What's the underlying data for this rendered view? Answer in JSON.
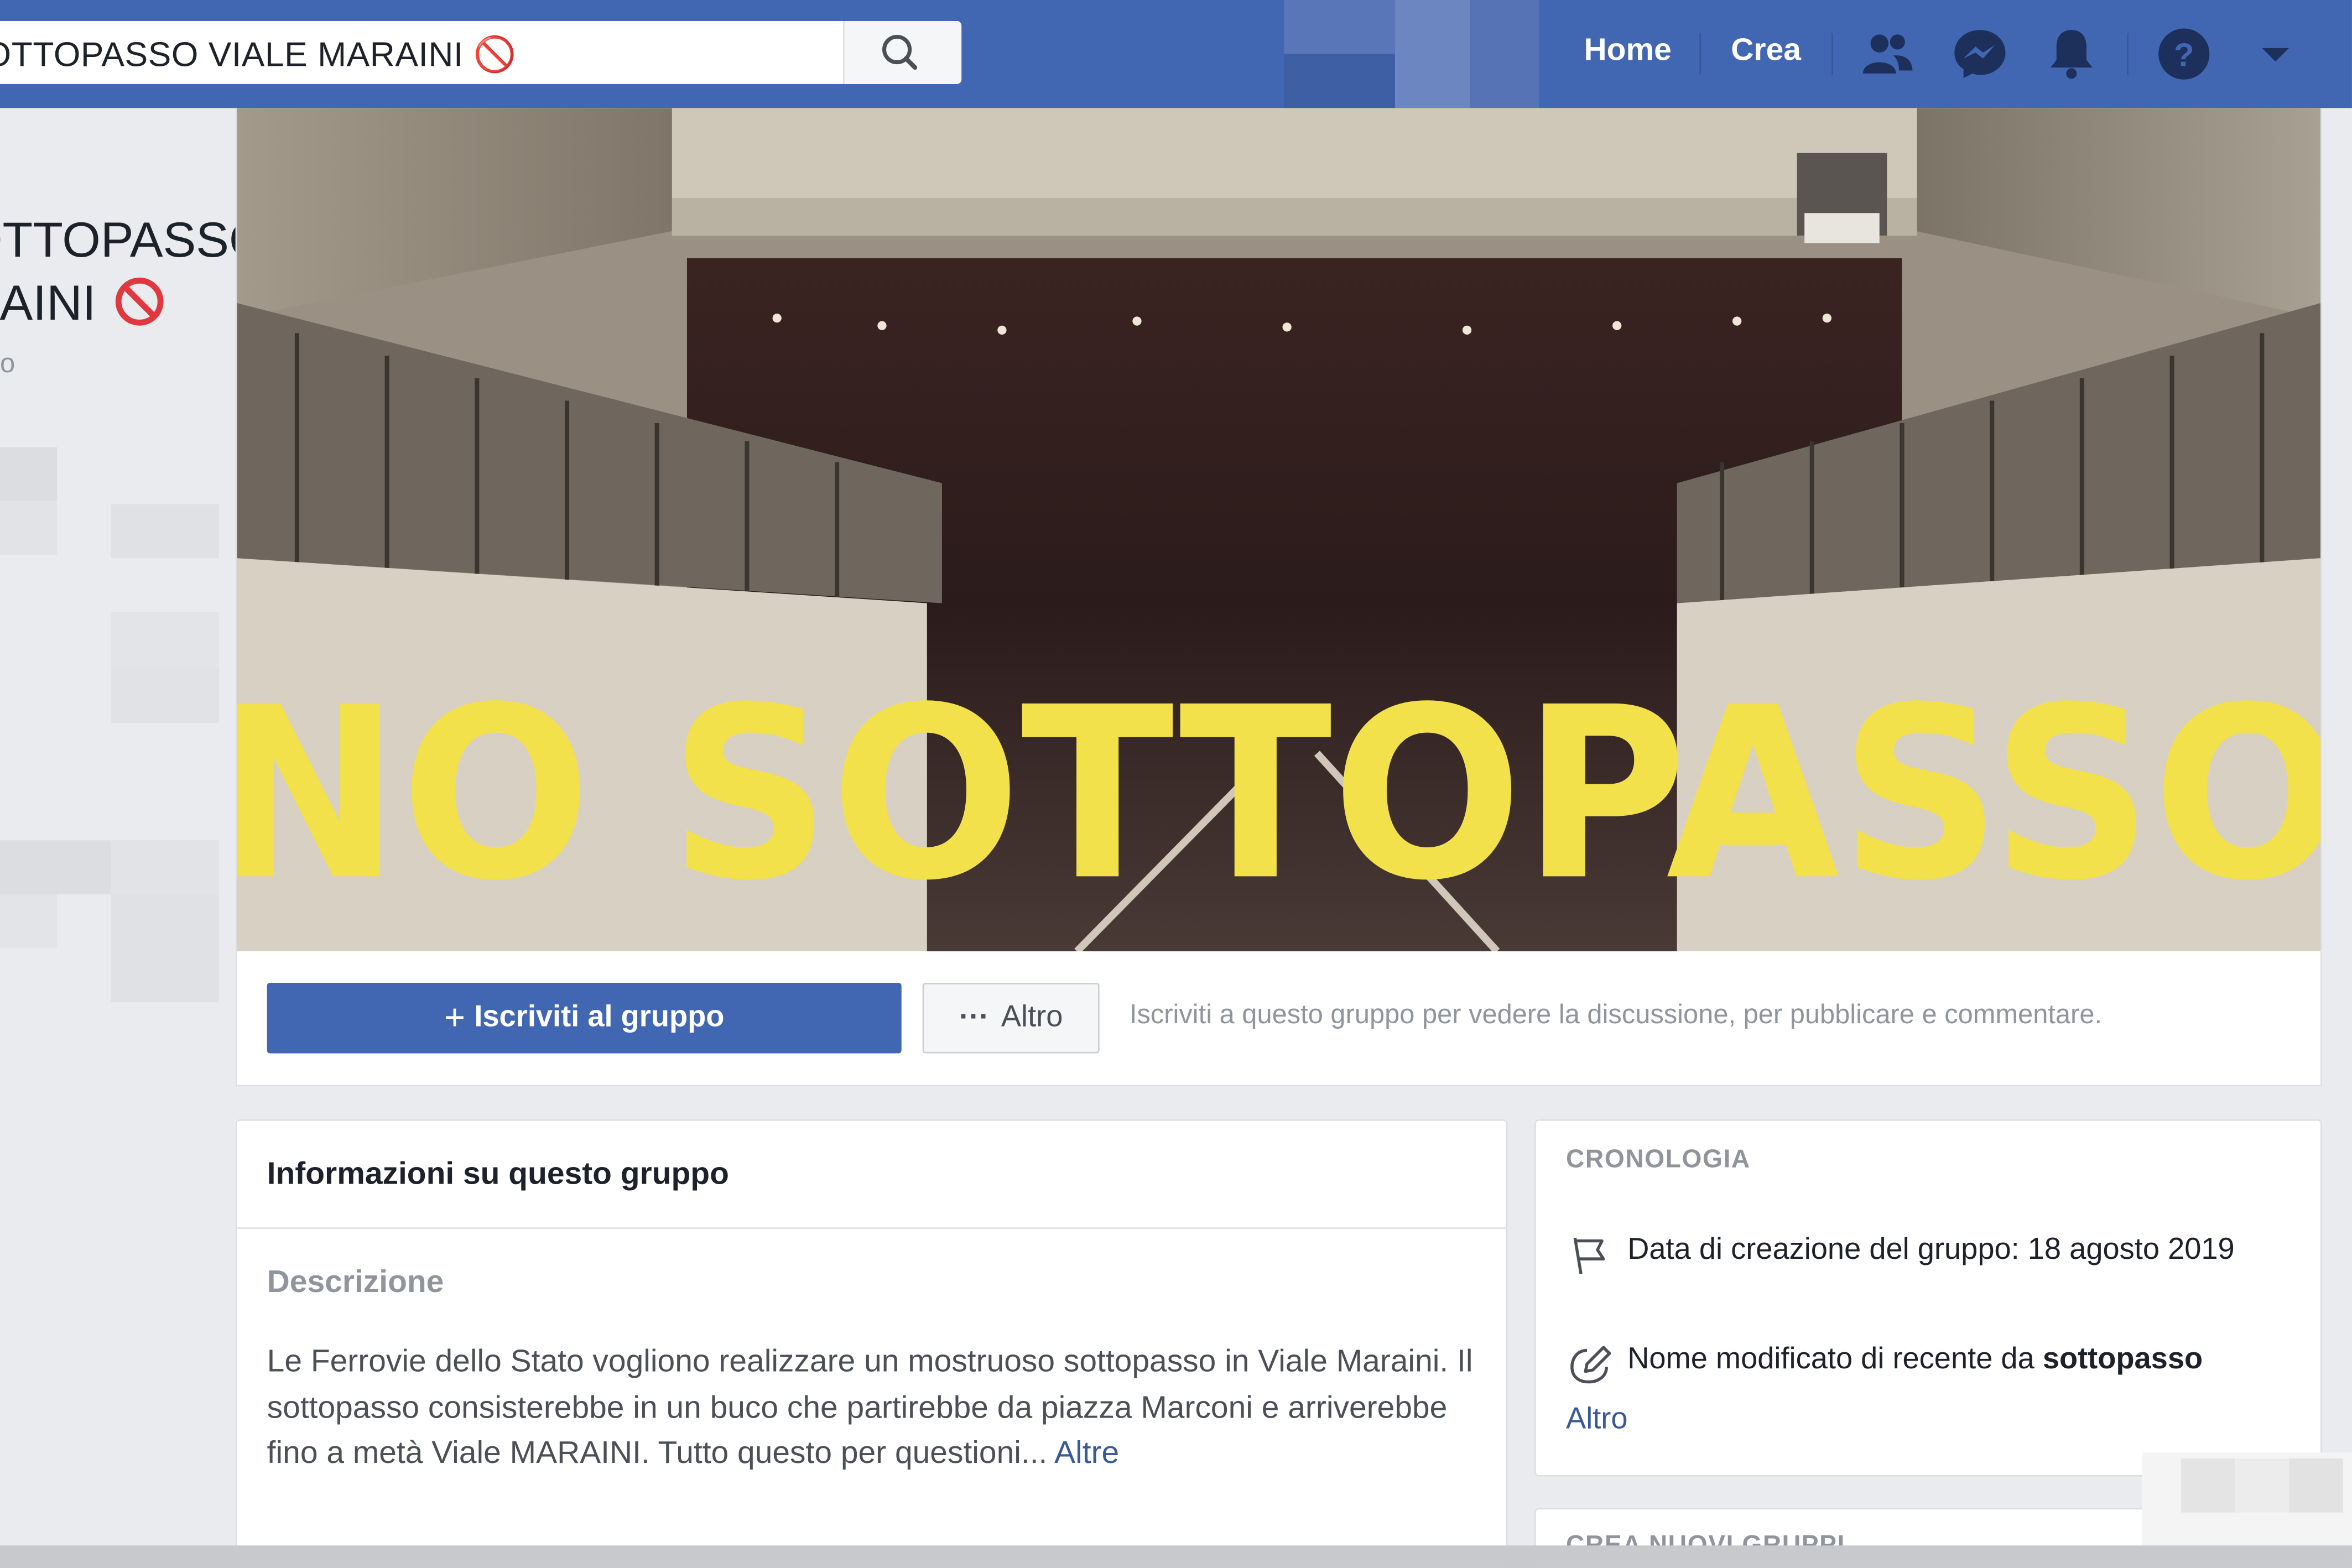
{
  "search": {
    "value": "SOTTOPASSO VIALE MARAINI 🚫"
  },
  "nav": {
    "home": "Home",
    "create": "Crea",
    "icons": [
      "friends-icon",
      "messenger-icon",
      "notifications-icon",
      "help-icon",
      "menu-arrow-icon"
    ]
  },
  "group": {
    "title_line1": "SOTTOPASSO",
    "title_line2": "RAINI",
    "title_emoji": "🚫",
    "subtitle": "o"
  },
  "cover": {
    "text": "NO SOTTOPASSO"
  },
  "actions": {
    "join_plus": "+",
    "join_label": "Iscriviti al gruppo",
    "more_dots": "···",
    "more_label": "Altro",
    "hint": "Iscriviti a questo gruppo per vedere la discussione, per pubblicare e commentare."
  },
  "about": {
    "heading": "Informazioni su questo gruppo",
    "description_label": "Descrizione",
    "description": "Le Ferrovie dello Stato vogliono realizzare un mostruoso sottopasso in Viale Maraini. Il sottopasso consisterebbe in un buco che partirebbe da piazza Marconi e arriverebbe fino a metà Viale MARAINI. Tutto questo per questioni...",
    "more_link": "Altre"
  },
  "timeline": {
    "heading": "CRONOLOGIA",
    "created_text": "Data di creazione del gruppo: 18 agosto 2019",
    "renamed_prefix": "Nome modificato di recente da",
    "renamed_by": "sottopasso",
    "more_link": "Altro",
    "next_heading": "CREA NUOVI GRUPPI"
  },
  "colors": {
    "brand": "#4267b2",
    "link": "#385898",
    "cover_text": "#f2e14a"
  }
}
